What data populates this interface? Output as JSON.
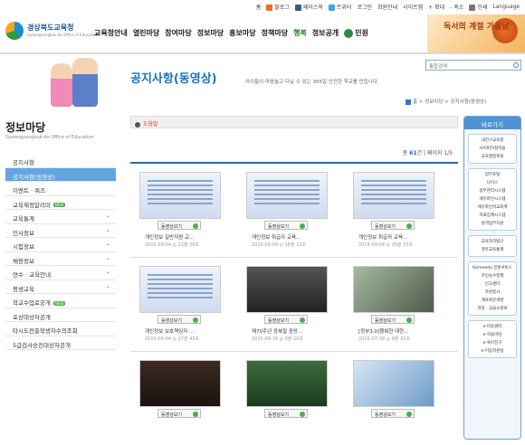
{
  "util": {
    "home": "홈",
    "blog": "블로그",
    "facebook": "페이스북",
    "twitter": "트위터",
    "login": "로그인",
    "join": "회원안내",
    "sitemap": "사이트맵",
    "zoom_in": "+ 확대",
    "zoom_out": "- 축소",
    "print": "인쇄",
    "language": "Language"
  },
  "logo": {
    "name": "경상북도교육청",
    "sub": "Gyeongsangbuk-do Office of Education"
  },
  "gnb": [
    "교육청안내",
    "열린마당",
    "참여마당",
    "정보마당",
    "홍보마당",
    "정책마당"
  ],
  "gnb_special": "행복",
  "gnb_info": "정보공개",
  "gnb_civil": "민원",
  "promo": "독서의 계절 가을날",
  "page": {
    "title": "공지사항(동영상)",
    "desc": "아이들이 마음놓고 다닐 수 있는 365일 안전한 학교를 만듭니다.",
    "search_placeholder": "통합검색",
    "breadcrumb": [
      "홈",
      "정보마당",
      "공지사항(동영상)"
    ]
  },
  "lnb": {
    "title": "정보마당",
    "subtitle": "Gyeongsangbuk-do Office of Education",
    "items": [
      {
        "label": "공지사항",
        "chev": false,
        "new": false,
        "active": false
      },
      {
        "label": "공지사항(동영상)",
        "chev": false,
        "new": false,
        "active": true
      },
      {
        "label": "이벤트 · 퀴즈",
        "chev": false,
        "new": false,
        "active": false
      },
      {
        "label": "교육재정알리미",
        "chev": false,
        "new": true,
        "active": false
      },
      {
        "label": "교육통계",
        "chev": true,
        "new": false,
        "active": false
      },
      {
        "label": "인사정보",
        "chev": true,
        "new": false,
        "active": false
      },
      {
        "label": "시험정보",
        "chev": true,
        "new": false,
        "active": false
      },
      {
        "label": "채용정보",
        "chev": true,
        "new": false,
        "active": false
      },
      {
        "label": "연수 · 교육안내",
        "chev": true,
        "new": false,
        "active": false
      },
      {
        "label": "평생교육",
        "chev": true,
        "new": false,
        "active": false
      },
      {
        "label": "학교수업료공개",
        "chev": false,
        "new": true,
        "active": false
      },
      {
        "label": "포상대상자공개",
        "chev": false,
        "new": false,
        "active": false
      },
      {
        "label": "타시도전출학생자수의조회",
        "chev": false,
        "new": false,
        "active": false
      },
      {
        "label": "5급검사승진대상자공개",
        "chev": false,
        "new": false,
        "active": false
      }
    ],
    "new_badge": "NEW"
  },
  "content": {
    "help": "도움말",
    "count_label": "총",
    "count": "61",
    "count_unit": "건",
    "page_label": "페이지 1/5",
    "play_label": "동영상보기",
    "cards": [
      {
        "title": "개인정보 일반직원 교...",
        "meta": "2015-09-04 ◎ 22분 26초",
        "thumb": "doc"
      },
      {
        "title": "개인정보 취급자 교육...",
        "meta": "2015-09-04 ◎ 16분 23초",
        "thumb": "doc"
      },
      {
        "title": "개인정보 취급자 교육...",
        "meta": "2015-09-04 ◎ 25분 33초",
        "thumb": "doc"
      },
      {
        "title": "개인정보 보호책임자 ...",
        "meta": "2015-09-04 ◎ 27분 45초",
        "thumb": "doc"
      },
      {
        "title": "제70주년 광복절 중앙...",
        "meta": "2015-08-18 ◎ 0분 20초",
        "thumb": "dark1"
      },
      {
        "title": "[정부3.0]행복한 대한...",
        "meta": "2015-07-30 ◎ 0분 20초",
        "thumb": "dark2"
      },
      {
        "title": "",
        "meta": "",
        "thumb": "dark3"
      },
      {
        "title": "",
        "meta": "",
        "thumb": "dark4"
      },
      {
        "title": "",
        "meta": "",
        "thumb": "dark5"
      }
    ]
  },
  "quick": {
    "title": "바로가기",
    "groups": [
      [
        "내친구교육청",
        "사이버가정학습",
        "교육행정포털"
      ],
      [
        "업무포털",
        "나이스",
        "업무관리시스템",
        "에듀파인시스템",
        "에듀파인학교회계",
        "자료집계시스템",
        "원격업무지원"
      ],
      [
        "교육자치법규",
        "경북교육통계"
      ],
      [
        "Homeedu 민원서비스",
        "주민숫수정책",
        "신고센터",
        "자원봉사",
        "계육복분개발",
        "학원 · 교습소정보"
      ],
      [
        "e-이동센터",
        "e-학습마당",
        "e-육아친구",
        "e-이동지원실"
      ]
    ]
  }
}
